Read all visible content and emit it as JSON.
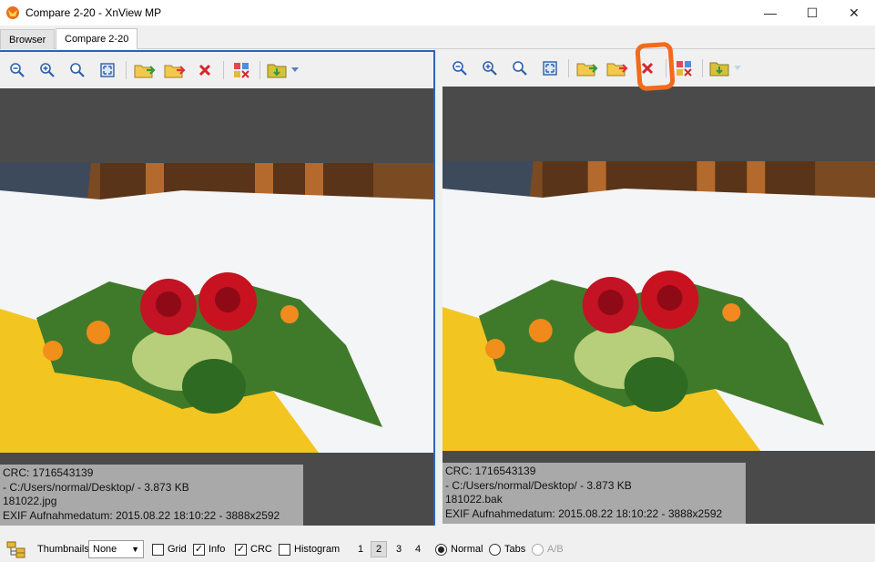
{
  "window": {
    "title": "Compare 2-20 - XnView MP",
    "controls": {
      "minimize": "—",
      "maximize": "☐",
      "close": "✕"
    }
  },
  "tabs": [
    {
      "label": "Browser",
      "active": false
    },
    {
      "label": "Compare 2-20",
      "active": true
    }
  ],
  "toolbar_icons": [
    "zoom-out-icon",
    "zoom-in-icon",
    "zoom-fit-icon",
    "fullscreen-icon",
    "copy-to-folder-icon",
    "move-to-folder-icon",
    "delete-icon",
    "compare-diff-icon",
    "open-folder-icon"
  ],
  "panels": {
    "left": {
      "info": {
        "crc": "CRC: 1716543139",
        "path": " - C:/Users/normal/Desktop/ - 3.873 KB",
        "filename": "181022.jpg",
        "exif": "EXIF Aufnahmedatum: 2015.08.22 18:10:22 - 3888x2592"
      }
    },
    "right": {
      "info": {
        "crc": "CRC: 1716543139",
        "path": " - C:/Users/normal/Desktop/ - 3.873 KB",
        "filename": "181022.bak",
        "exif": "EXIF Aufnahmedatum: 2015.08.22 18:10:22 - 3888x2592"
      }
    }
  },
  "statusbar": {
    "thumbnails_label": "Thumbnails",
    "thumbnails_value": "None",
    "grid_label": "Grid",
    "grid_checked": false,
    "info_label": "Info",
    "info_checked": true,
    "crc_label": "CRC",
    "crc_checked": true,
    "histogram_label": "Histogram",
    "histogram_checked": false,
    "layout_numbers": [
      "1",
      "2",
      "3",
      "4"
    ],
    "layout_selected": "2",
    "mode_normal": "Normal",
    "mode_tabs": "Tabs",
    "mode_ab": "A/B",
    "mode_selected": "Normal"
  },
  "colors": {
    "accent_border": "#2f64b4",
    "annotation": "#f36a1a",
    "viewport_bg": "#4a4a4a",
    "info_bg": "#a9a9a9"
  }
}
